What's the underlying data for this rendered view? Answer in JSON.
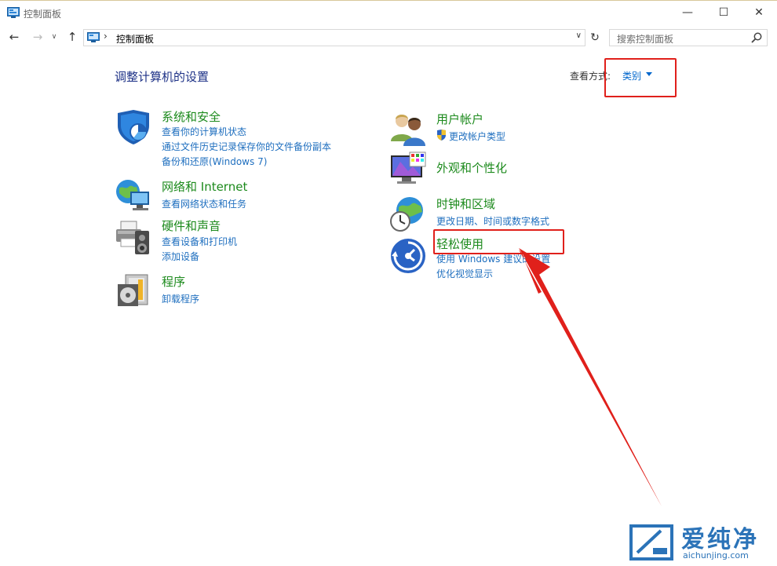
{
  "window": {
    "title": "控制面板",
    "min_glyph": "—",
    "max_glyph": "☐",
    "close_glyph": "✕"
  },
  "nav": {
    "back_glyph": "←",
    "forward_glyph": "→",
    "recent_glyph": "∨",
    "up_glyph": "↑",
    "refresh_glyph": "↻",
    "address_chevron": "›",
    "address_dropdown": "∨",
    "address_path": "控制面板",
    "search_placeholder": "搜索控制面板"
  },
  "header": {
    "title": "调整计算机的设置",
    "view_by_label": "查看方式:",
    "view_by_value": "类别"
  },
  "categories": [
    {
      "title": "系统和安全",
      "icon": "security-shield-icon",
      "links": [
        "查看你的计算机状态",
        "通过文件历史记录保存你的文件备份副本",
        "备份和还原(Windows 7)"
      ]
    },
    {
      "title": "网络和 Internet",
      "icon": "network-globe-icon",
      "links": [
        "查看网络状态和任务"
      ]
    },
    {
      "title": "硬件和声音",
      "icon": "printer-speaker-icon",
      "links": [
        "查看设备和打印机",
        "添加设备"
      ]
    },
    {
      "title": "程序",
      "icon": "programs-disc-icon",
      "links": [
        "卸载程序"
      ]
    },
    {
      "title": "用户帐户",
      "icon": "users-icon",
      "links": [
        "更改帐户类型"
      ]
    },
    {
      "title": "外观和个性化",
      "icon": "monitor-palette-icon",
      "links": []
    },
    {
      "title": "时钟和区域",
      "icon": "clock-globe-icon",
      "links": [
        "更改日期、时间或数字格式"
      ]
    },
    {
      "title": "轻松使用",
      "icon": "ease-of-access-icon",
      "links": [
        "使用 Windows 建议的设置",
        "优化视觉显示"
      ]
    }
  ],
  "watermark": {
    "text": "爱纯净",
    "url": "aichunjing.com"
  },
  "colors": {
    "category_title": "#1c8a1c",
    "link": "#1f6fbf",
    "page_title": "#1e3287",
    "annotation_red": "#e0201b"
  }
}
